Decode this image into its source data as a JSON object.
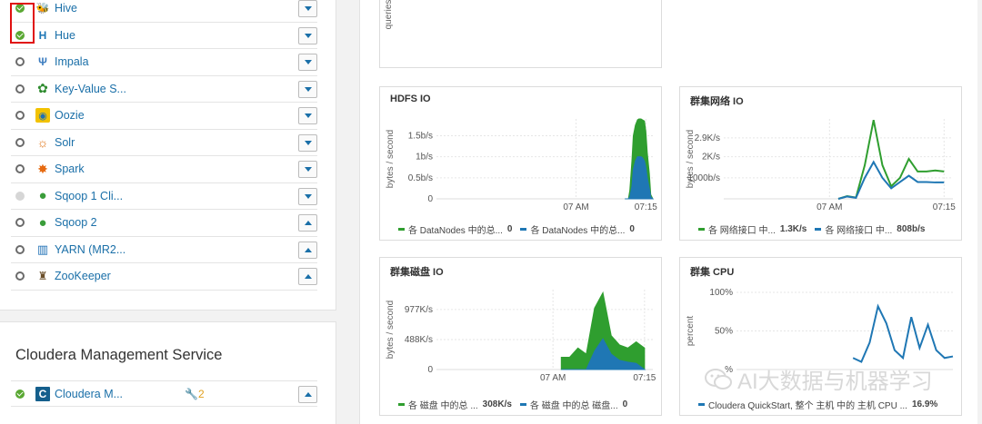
{
  "services": [
    {
      "name": "Hive",
      "status": "ok",
      "icon": "hive-icon",
      "caret": "down"
    },
    {
      "name": "Hue",
      "status": "ok",
      "icon": "hue-icon",
      "caret": "down"
    },
    {
      "name": "Impala",
      "status": "stopped",
      "icon": "impala-icon",
      "caret": "down"
    },
    {
      "name": "Key-Value S...",
      "status": "stopped",
      "icon": "key-value-icon",
      "caret": "down"
    },
    {
      "name": "Oozie",
      "status": "stopped",
      "icon": "oozie-icon",
      "caret": "down"
    },
    {
      "name": "Solr",
      "status": "stopped",
      "icon": "solr-icon",
      "caret": "down"
    },
    {
      "name": "Spark",
      "status": "stopped",
      "icon": "spark-icon",
      "caret": "down"
    },
    {
      "name": "Sqoop 1 Cli...",
      "status": "disabled",
      "icon": "sqoop-icon",
      "caret": "down"
    },
    {
      "name": "Sqoop 2",
      "status": "stopped",
      "icon": "sqoop-icon",
      "caret": "up"
    },
    {
      "name": "YARN (MR2...",
      "status": "stopped",
      "icon": "yarn-icon",
      "caret": "up"
    },
    {
      "name": "ZooKeeper",
      "status": "stopped",
      "icon": "zookeeper-icon",
      "caret": "up"
    }
  ],
  "cms": {
    "title": "Cloudera Management Service",
    "row": {
      "name": "Cloudera M...",
      "status": "ok",
      "icon": "cloudera-icon",
      "badge_icon": "wrench-icon",
      "badge": "2"
    }
  },
  "colors": {
    "green": "#2f9e2f",
    "blue": "#1f77b4",
    "link": "#1a6fa8"
  },
  "watermark": "AI大数据与机器学习",
  "chart_data": [
    {
      "type": "line",
      "title": "",
      "ylabel": "queries",
      "x": [],
      "series": []
    },
    {
      "type": "area",
      "title": "HDFS IO",
      "ylabel": "bytes / second",
      "ytick_labels": [
        "0",
        "0.5b/s",
        "1b/s",
        "1.5b/s"
      ],
      "yticks": [
        0,
        0.5,
        1,
        1.5
      ],
      "ylim": [
        0,
        1.9
      ],
      "xtick_labels": [
        "07 AM",
        "07:15"
      ],
      "xticks": [
        20,
        30
      ],
      "xlim": [
        0,
        31
      ],
      "x": [
        27,
        27.5,
        27.7,
        28,
        28.2,
        28.5,
        28.8,
        29,
        29.3,
        29.5,
        29.8,
        30,
        30.2,
        30.5,
        30.7,
        31
      ],
      "series": [
        {
          "name": "各 DataNodes 中的总...",
          "legend_value": "0",
          "color": "#2f9e2f",
          "values": [
            0,
            0,
            0.2,
            0.9,
            1.5,
            1.75,
            1.88,
            1.9,
            1.9,
            1.88,
            1.85,
            1.6,
            1.1,
            0.6,
            0.1,
            0
          ]
        },
        {
          "name": "各 DataNodes 中的总...",
          "legend_value": "0",
          "color": "#1f77b4",
          "values": [
            0,
            0,
            0.05,
            0.3,
            0.7,
            0.9,
            1.0,
            1.0,
            1.0,
            0.98,
            0.9,
            0.75,
            0.5,
            0.25,
            0.05,
            0
          ]
        }
      ]
    },
    {
      "type": "line",
      "title": "群集网络 IO",
      "ylabel": "bytes / second",
      "ytick_labels": [
        "1000b/s",
        "2K/s",
        "2.9K/s"
      ],
      "yticks": [
        1000,
        2000,
        2900
      ],
      "ylim": [
        0,
        3800
      ],
      "xtick_labels": [
        "07 AM",
        "07:15"
      ],
      "xticks": [
        12,
        25
      ],
      "xlim": [
        0,
        26
      ],
      "x": [
        13,
        14,
        15,
        16,
        17,
        18,
        19,
        20,
        21,
        22,
        23,
        24,
        25
      ],
      "series": [
        {
          "name": "各 网络接口 中...",
          "legend_value": "1.3K/s",
          "color": "#2f9e2f",
          "values": [
            0,
            130,
            60,
            1600,
            3750,
            1600,
            600,
            1000,
            1900,
            1300,
            1300,
            1350,
            1300
          ]
        },
        {
          "name": "各 网络接口 中...",
          "legend_value": "808b/s",
          "color": "#1f77b4",
          "values": [
            0,
            110,
            50,
            1000,
            1750,
            1000,
            500,
            800,
            1100,
            800,
            800,
            780,
            780
          ]
        }
      ]
    },
    {
      "type": "area",
      "title": "群集磁盘 IO",
      "ylabel": "bytes / second",
      "ytick_labels": [
        "0",
        "488K/s",
        "977K/s"
      ],
      "yticks": [
        0,
        488,
        977
      ],
      "ylim": [
        0,
        1300
      ],
      "xtick_labels": [
        "07 AM",
        "07:15"
      ],
      "xticks": [
        14,
        25
      ],
      "xlim": [
        0,
        26
      ],
      "x": [
        15,
        16,
        17,
        18,
        19,
        20,
        21,
        22,
        23,
        24,
        25
      ],
      "series": [
        {
          "name": "各 磁盘 中的总 ...",
          "legend_value": "308K/s",
          "color": "#2f9e2f",
          "values": [
            200,
            200,
            350,
            250,
            1000,
            1250,
            550,
            400,
            350,
            450,
            350
          ]
        },
        {
          "name": "各 磁盘 中的总 磁盘...",
          "legend_value": "0",
          "color": "#1f77b4",
          "values": [
            0,
            0,
            0,
            0,
            300,
            500,
            250,
            150,
            120,
            100,
            0
          ]
        }
      ]
    },
    {
      "type": "line",
      "title": "群集 CPU",
      "ylabel": "percent",
      "ytick_labels": [
        "%",
        "50%",
        "100%"
      ],
      "yticks": [
        0,
        50,
        100
      ],
      "ylim": [
        0,
        100
      ],
      "xtick_labels": [],
      "xticks": [],
      "xlim": [
        0,
        26
      ],
      "x": [
        14,
        15,
        16,
        17,
        18,
        19,
        20,
        21,
        22,
        23,
        24,
        25,
        26
      ],
      "series": [
        {
          "name": "Cloudera QuickStart, 整个 主机 中的 主机 CPU ...",
          "legend_value": "16.9%",
          "color": "#1f77b4",
          "values": [
            15,
            10,
            35,
            82,
            60,
            25,
            15,
            68,
            28,
            58,
            25,
            15,
            17
          ]
        }
      ]
    }
  ]
}
